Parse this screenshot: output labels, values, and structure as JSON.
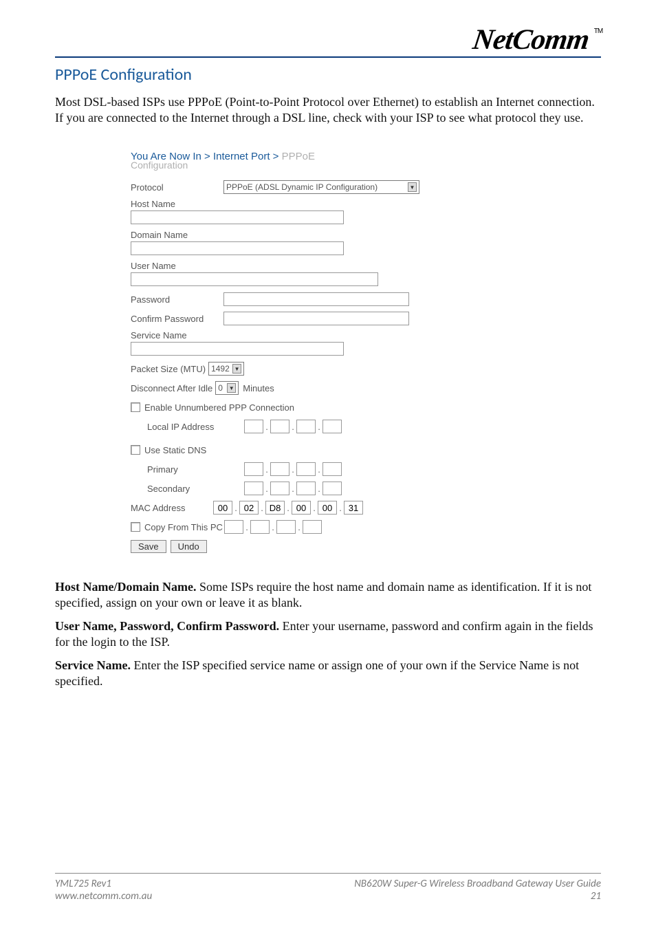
{
  "header": {
    "logo_text": "NetComm",
    "tm": "TM"
  },
  "title": "PPPoE Configuration",
  "intro": "Most DSL-based ISPs use PPPoE (Point-to-Point Protocol over Ethernet) to establish an Internet connection. If you are connected to the Internet through a DSL line, check with your ISP to see what protocol they use.",
  "breadcrumb": {
    "prefix": "You Are Now In > Internet Port > ",
    "last": "PPPoE",
    "sub": "Configuration"
  },
  "form": {
    "protocol_label": "Protocol",
    "protocol_value": "PPPoE (ADSL Dynamic IP Configuration)",
    "host_name_label": "Host Name",
    "domain_name_label": "Domain Name",
    "user_name_label": "User Name",
    "password_label": "Password",
    "confirm_password_label": "Confirm Password",
    "service_name_label": "Service Name",
    "mtu_label": "Packet Size (MTU)",
    "mtu_value": "1492",
    "disconnect_label": "Disconnect After Idle",
    "disconnect_value": "0",
    "disconnect_suffix": "Minutes",
    "enable_unnumbered_label": "Enable Unnumbered PPP Connection",
    "local_ip_label": "Local IP Address",
    "use_static_dns_label": "Use Static DNS",
    "primary_label": "Primary",
    "secondary_label": "Secondary",
    "mac_label": "MAC Address",
    "mac": [
      "00",
      "02",
      "D8",
      "00",
      "00",
      "31"
    ],
    "copy_pc_label": "Copy From This PC",
    "save_label": "Save",
    "undo_label": "Undo"
  },
  "para_host_strong": "Host Name/Domain Name.",
  "para_host": " Some ISPs require the host name and domain name as identification.  If it is not specified, assign on your own or leave it as blank.",
  "para_user_strong": "User Name, Password, Confirm Password.",
  "para_user": " Enter your username, password and confirm again in the fields for the login to the ISP.",
  "para_service_strong": "Service Name.",
  "para_service": " Enter the ISP specified service name or assign one of your own if the Service Name is not specified.",
  "footer": {
    "left1": "YML725 Rev1",
    "left2": "www.netcomm.com.au",
    "right1": "NB620W Super-G Wireless Broadband  Gateway User Guide",
    "right2": "21"
  }
}
